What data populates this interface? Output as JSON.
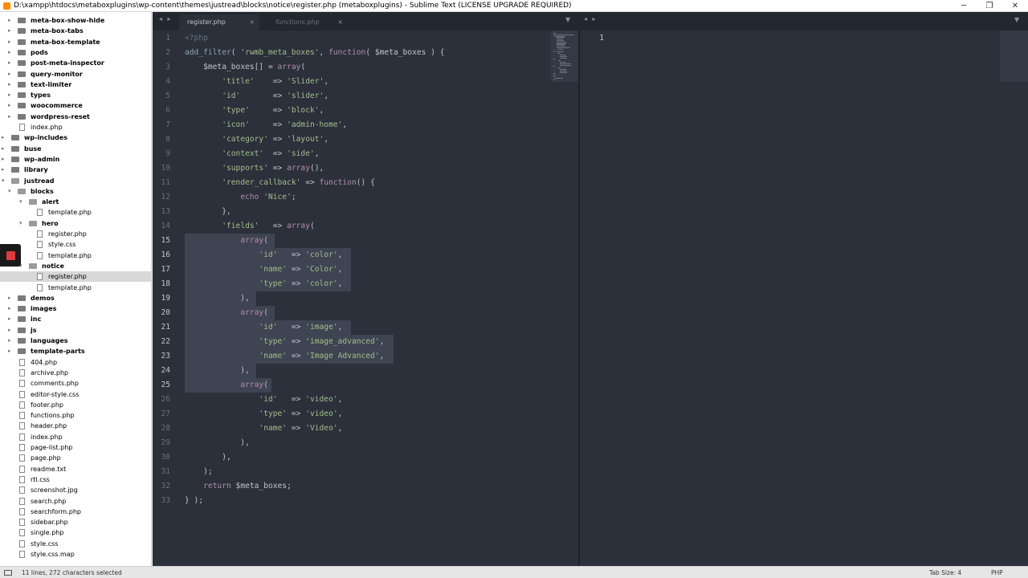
{
  "window": {
    "title": "D:\\xampp\\htdocs\\metaboxplugins\\wp-content\\themes\\justread\\blocks\\notice\\register.php (metaboxplugins) - Sublime Text (LICENSE UPGRADE REQUIRED)",
    "minimize": "─",
    "maximize": "❐",
    "close": "✕"
  },
  "sidebar": {
    "items": [
      {
        "label": "meta-box-show-hide",
        "type": "folder",
        "depth": 2,
        "state": "closed"
      },
      {
        "label": "meta-box-tabs",
        "type": "folder",
        "depth": 2,
        "state": "closed"
      },
      {
        "label": "meta-box-template",
        "type": "folder",
        "depth": 2,
        "state": "closed"
      },
      {
        "label": "pods",
        "type": "folder",
        "depth": 2,
        "state": "closed"
      },
      {
        "label": "post-meta-inspector",
        "type": "folder",
        "depth": 2,
        "state": "closed"
      },
      {
        "label": "query-monitor",
        "type": "folder",
        "depth": 2,
        "state": "closed"
      },
      {
        "label": "text-limiter",
        "type": "folder",
        "depth": 2,
        "state": "closed"
      },
      {
        "label": "types",
        "type": "folder",
        "depth": 2,
        "state": "closed"
      },
      {
        "label": "woocommerce",
        "type": "folder",
        "depth": 2,
        "state": "closed"
      },
      {
        "label": "wordpress-reset",
        "type": "folder",
        "depth": 2,
        "state": "closed"
      },
      {
        "label": "index.php",
        "type": "file",
        "depth": 2
      },
      {
        "label": "wp-includes",
        "type": "folder",
        "depth": 1,
        "state": "closed"
      },
      {
        "label": "buse",
        "type": "folder",
        "depth": 1,
        "state": "closed"
      },
      {
        "label": "wp-admin",
        "type": "folder",
        "depth": 1,
        "state": "closed"
      },
      {
        "label": "library",
        "type": "folder",
        "depth": 1,
        "state": "closed"
      },
      {
        "label": "justread",
        "type": "folder",
        "depth": 1,
        "state": "open"
      },
      {
        "label": "blocks",
        "type": "folder",
        "depth": 2,
        "state": "open"
      },
      {
        "label": "alert",
        "type": "folder",
        "depth": 3,
        "state": "open"
      },
      {
        "label": "template.php",
        "type": "file",
        "depth": 4
      },
      {
        "label": "hero",
        "type": "folder",
        "depth": 3,
        "state": "open"
      },
      {
        "label": "register.php",
        "type": "file",
        "depth": 4
      },
      {
        "label": "style.css",
        "type": "file",
        "depth": 4,
        "prefix": "/*"
      },
      {
        "label": "template.php",
        "type": "file",
        "depth": 4
      },
      {
        "label": "notice",
        "type": "folder",
        "depth": 3,
        "state": "open"
      },
      {
        "label": "register.php",
        "type": "file",
        "depth": 4,
        "selected": true
      },
      {
        "label": "template.php",
        "type": "file",
        "depth": 4
      },
      {
        "label": "demos",
        "type": "folder",
        "depth": 2,
        "state": "closed"
      },
      {
        "label": "images",
        "type": "folder",
        "depth": 2,
        "state": "closed"
      },
      {
        "label": "inc",
        "type": "folder",
        "depth": 2,
        "state": "closed"
      },
      {
        "label": "js",
        "type": "folder",
        "depth": 2,
        "state": "closed"
      },
      {
        "label": "languages",
        "type": "folder",
        "depth": 2,
        "state": "closed"
      },
      {
        "label": "template-parts",
        "type": "folder",
        "depth": 2,
        "state": "closed"
      },
      {
        "label": "404.php",
        "type": "file",
        "depth": 2
      },
      {
        "label": "archive.php",
        "type": "file",
        "depth": 2
      },
      {
        "label": "comments.php",
        "type": "file",
        "depth": 2
      },
      {
        "label": "editor-style.css",
        "type": "file",
        "depth": 2,
        "prefix": "/*"
      },
      {
        "label": "footer.php",
        "type": "file",
        "depth": 2
      },
      {
        "label": "functions.php",
        "type": "file",
        "depth": 2
      },
      {
        "label": "header.php",
        "type": "file",
        "depth": 2
      },
      {
        "label": "index.php",
        "type": "file",
        "depth": 2
      },
      {
        "label": "page-list.php",
        "type": "file",
        "depth": 2
      },
      {
        "label": "page.php",
        "type": "file",
        "depth": 2
      },
      {
        "label": "readme.txt",
        "type": "file",
        "depth": 2,
        "prefix": "≡"
      },
      {
        "label": "rtl.css",
        "type": "file",
        "depth": 2,
        "prefix": "/*"
      },
      {
        "label": "screenshot.jpg",
        "type": "file",
        "depth": 2
      },
      {
        "label": "search.php",
        "type": "file",
        "depth": 2
      },
      {
        "label": "searchform.php",
        "type": "file",
        "depth": 2
      },
      {
        "label": "sidebar.php",
        "type": "file",
        "depth": 2
      },
      {
        "label": "single.php",
        "type": "file",
        "depth": 2
      },
      {
        "label": "style.css",
        "type": "file",
        "depth": 2,
        "prefix": "/*"
      },
      {
        "label": "style.css.map",
        "type": "file",
        "depth": 2
      }
    ]
  },
  "tabs": {
    "nav": "◂ ▸",
    "left": [
      {
        "label": "register.php",
        "active": true
      },
      {
        "label": "functions.php",
        "active": false
      }
    ],
    "close_glyph": "×",
    "dropdown_glyph": "▼"
  },
  "editor": {
    "selected_lines": [
      15,
      16,
      17,
      18,
      19,
      20,
      21,
      22,
      23,
      24,
      25
    ],
    "lines": [
      [
        [
          "tag",
          "<?php"
        ]
      ],
      [
        [
          "fn",
          "add_filter"
        ],
        [
          "op",
          "( "
        ],
        [
          "str",
          "'rwmb_meta_boxes'"
        ],
        [
          "op",
          ", "
        ],
        [
          "kw",
          "function"
        ],
        [
          "op",
          "( "
        ],
        [
          "var",
          "$meta_boxes"
        ],
        [
          "op",
          " ) {"
        ]
      ],
      [
        [
          "op",
          "    "
        ],
        [
          "var",
          "$meta_boxes"
        ],
        [
          "op",
          "[] = "
        ],
        [
          "kw",
          "array"
        ],
        [
          "op",
          "("
        ]
      ],
      [
        [
          "op",
          "        "
        ],
        [
          "str",
          "'title'"
        ],
        [
          "op",
          "    => "
        ],
        [
          "str",
          "'Slider'"
        ],
        [
          "op",
          ","
        ]
      ],
      [
        [
          "op",
          "        "
        ],
        [
          "str",
          "'id'"
        ],
        [
          "op",
          "       => "
        ],
        [
          "str",
          "'slider'"
        ],
        [
          "op",
          ","
        ]
      ],
      [
        [
          "op",
          "        "
        ],
        [
          "str",
          "'type'"
        ],
        [
          "op",
          "     => "
        ],
        [
          "str",
          "'block'"
        ],
        [
          "op",
          ","
        ]
      ],
      [
        [
          "op",
          "        "
        ],
        [
          "str",
          "'icon'"
        ],
        [
          "op",
          "     => "
        ],
        [
          "str",
          "'admin-home'"
        ],
        [
          "op",
          ","
        ]
      ],
      [
        [
          "op",
          "        "
        ],
        [
          "str",
          "'category'"
        ],
        [
          "op",
          " => "
        ],
        [
          "str",
          "'layout'"
        ],
        [
          "op",
          ","
        ]
      ],
      [
        [
          "op",
          "        "
        ],
        [
          "str",
          "'context'"
        ],
        [
          "op",
          "  => "
        ],
        [
          "str",
          "'side'"
        ],
        [
          "op",
          ","
        ]
      ],
      [
        [
          "op",
          "        "
        ],
        [
          "str",
          "'supports'"
        ],
        [
          "op",
          " => "
        ],
        [
          "kw",
          "array"
        ],
        [
          "op",
          "(),"
        ]
      ],
      [
        [
          "op",
          "        "
        ],
        [
          "str",
          "'render_callback'"
        ],
        [
          "op",
          " => "
        ],
        [
          "kw",
          "function"
        ],
        [
          "op",
          "() {"
        ]
      ],
      [
        [
          "op",
          "            "
        ],
        [
          "echo-kw",
          "echo"
        ],
        [
          "op",
          " "
        ],
        [
          "str",
          "'Nice'"
        ],
        [
          "op",
          ";"
        ]
      ],
      [
        [
          "op",
          "        },"
        ]
      ],
      [
        [
          "op",
          "        "
        ],
        [
          "str",
          "'fields'"
        ],
        [
          "op",
          "   => "
        ],
        [
          "kw",
          "array"
        ],
        [
          "op",
          "("
        ]
      ],
      [
        [
          "op",
          "            "
        ],
        [
          "kw",
          "array"
        ],
        [
          "op",
          "("
        ]
      ],
      [
        [
          "op",
          "                "
        ],
        [
          "str",
          "'id'"
        ],
        [
          "op",
          "   => "
        ],
        [
          "str",
          "'color'"
        ],
        [
          "op",
          ","
        ]
      ],
      [
        [
          "op",
          "                "
        ],
        [
          "str",
          "'name'"
        ],
        [
          "op",
          " => "
        ],
        [
          "str",
          "'Color'"
        ],
        [
          "op",
          ","
        ]
      ],
      [
        [
          "op",
          "                "
        ],
        [
          "str",
          "'type'"
        ],
        [
          "op",
          " => "
        ],
        [
          "str",
          "'color'"
        ],
        [
          "op",
          ","
        ]
      ],
      [
        [
          "op",
          "            ),"
        ]
      ],
      [
        [
          "op",
          "            "
        ],
        [
          "kw",
          "array"
        ],
        [
          "op",
          "("
        ]
      ],
      [
        [
          "op",
          "                "
        ],
        [
          "str",
          "'id'"
        ],
        [
          "op",
          "   => "
        ],
        [
          "str",
          "'image'"
        ],
        [
          "op",
          ","
        ]
      ],
      [
        [
          "op",
          "                "
        ],
        [
          "str",
          "'type'"
        ],
        [
          "op",
          " => "
        ],
        [
          "str",
          "'image_advanced'"
        ],
        [
          "op",
          ","
        ]
      ],
      [
        [
          "op",
          "                "
        ],
        [
          "str",
          "'name'"
        ],
        [
          "op",
          " => "
        ],
        [
          "str",
          "'Image Advanced'"
        ],
        [
          "op",
          ","
        ]
      ],
      [
        [
          "op",
          "            ),"
        ]
      ],
      [
        [
          "op",
          "            "
        ],
        [
          "kw",
          "array"
        ],
        [
          "op",
          "("
        ]
      ],
      [
        [
          "op",
          "                "
        ],
        [
          "str",
          "'id'"
        ],
        [
          "op",
          "   => "
        ],
        [
          "str",
          "'video'"
        ],
        [
          "op",
          ","
        ]
      ],
      [
        [
          "op",
          "                "
        ],
        [
          "str",
          "'type'"
        ],
        [
          "op",
          " => "
        ],
        [
          "str",
          "'video'"
        ],
        [
          "op",
          ","
        ]
      ],
      [
        [
          "op",
          "                "
        ],
        [
          "str",
          "'name'"
        ],
        [
          "op",
          " => "
        ],
        [
          "str",
          "'Video'"
        ],
        [
          "op",
          ","
        ]
      ],
      [
        [
          "op",
          "            ),"
        ]
      ],
      [
        [
          "op",
          "        ),"
        ]
      ],
      [
        [
          "op",
          "    );"
        ]
      ],
      [
        [
          "op",
          "    "
        ],
        [
          "kw",
          "return"
        ],
        [
          "op",
          " "
        ],
        [
          "var",
          "$meta_boxes"
        ],
        [
          "op",
          ";"
        ]
      ],
      [
        [
          "op",
          "} );"
        ]
      ]
    ]
  },
  "pane2": {
    "line_number": "1"
  },
  "statusbar": {
    "selection": "11 lines, 272 characters selected",
    "tab_size": "Tab Size: 4",
    "syntax": "PHP"
  },
  "colors": {
    "editor_bg": "#2b303b",
    "string": "#a3be8c",
    "keyword": "#b48ead",
    "function": "#8fa1b3",
    "selection": "#3e4451",
    "record_button": "#e03a3a"
  }
}
